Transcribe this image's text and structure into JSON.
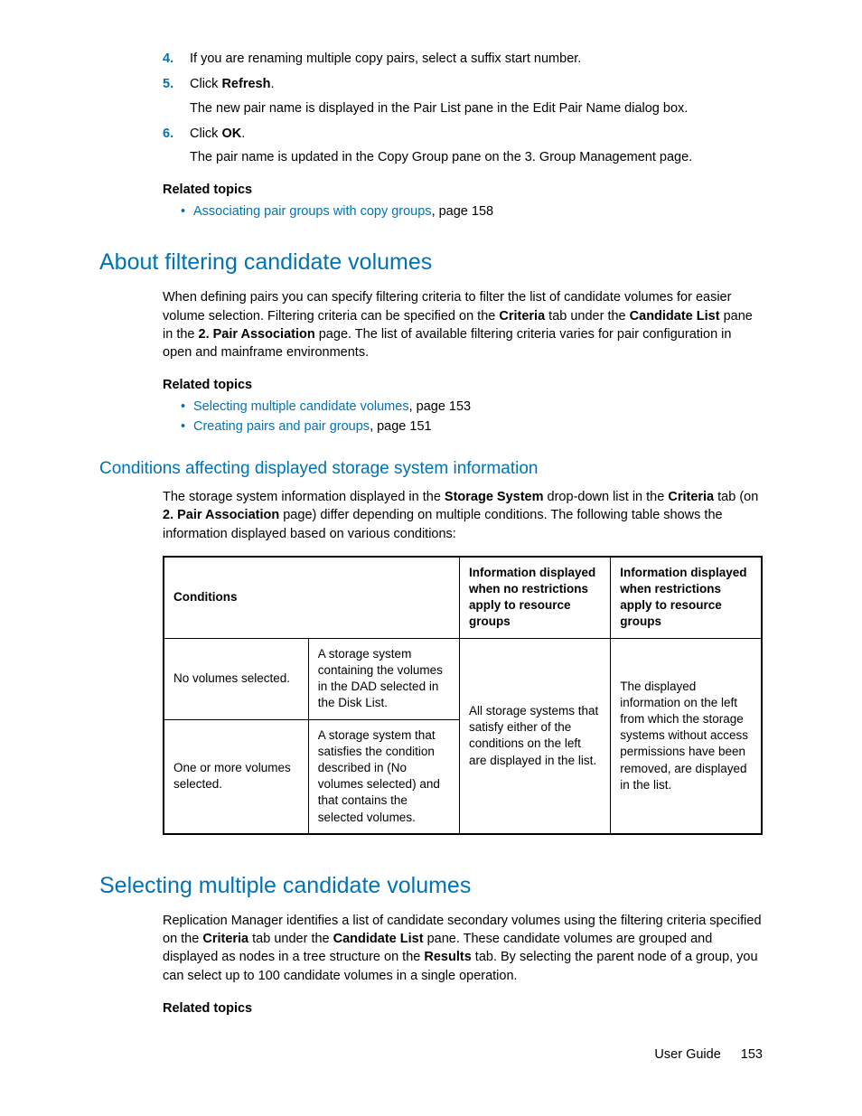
{
  "steps": [
    {
      "num": "4.",
      "text": "If you are renaming multiple copy pairs, select a suffix start number."
    },
    {
      "num": "5.",
      "prefix": "Click ",
      "bold": "Refresh",
      "suffix": ".",
      "sub": "The new pair name is displayed in the Pair List pane in the Edit Pair Name dialog box."
    },
    {
      "num": "6.",
      "prefix": "Click ",
      "bold": "OK",
      "suffix": ".",
      "sub": "The pair name is updated in the Copy Group pane on the 3. Group Management page."
    }
  ],
  "related_heading": "Related topics",
  "related1": [
    {
      "link": "Associating pair groups with copy groups",
      "tail": ", page 158"
    }
  ],
  "section1": {
    "heading": "About filtering candidate volumes",
    "para_parts": [
      "When defining pairs you can specify filtering criteria to filter the list of candidate volumes for easier volume selection. Filtering criteria can be specified on the ",
      "Criteria",
      " tab under the ",
      "Candidate List",
      " pane in the ",
      "2. Pair Association",
      " page. The list of available filtering criteria varies for pair configuration in open and mainframe environments."
    ]
  },
  "related2": [
    {
      "link": "Selecting multiple candidate volumes",
      "tail": ", page 153"
    },
    {
      "link": "Creating pairs and pair groups",
      "tail": ", page 151"
    }
  ],
  "subsection": {
    "heading": "Conditions affecting displayed storage system information",
    "para_parts": [
      "The storage system information displayed in the ",
      "Storage System",
      " drop-down list in the ",
      "Criteria",
      " tab (on ",
      "2. Pair Association",
      " page) differ depending on multiple conditions. The following table shows the information displayed based on various conditions:"
    ]
  },
  "table": {
    "headers": [
      "Conditions",
      "Information displayed when no restrictions apply to resource groups",
      "Information displayed when restrictions apply to resource groups"
    ],
    "rows": [
      {
        "c1": "No volumes selected.",
        "c2": "A storage system containing the volumes in the DAD selected in the Disk List."
      },
      {
        "c1": "One or more volumes selected.",
        "c2": "A storage system that satisfies the condition described in (No volumes selected) and that contains the selected volumes."
      }
    ],
    "merged_col3": "All storage systems that satisfy either of the conditions on the left are displayed in the list.",
    "merged_col4": "The displayed information on the left from which the storage systems without access permissions have been removed, are displayed in the list."
  },
  "section2": {
    "heading": "Selecting multiple candidate volumes",
    "para_parts": [
      "Replication Manager identifies a list of candidate secondary volumes using the filtering criteria specified on the ",
      "Criteria",
      " tab under the ",
      "Candidate List",
      " pane. These candidate volumes are grouped and displayed as nodes in a tree structure on the ",
      "Results",
      " tab.  By selecting the parent node of a group, you can select up to 100 candidate volumes in a single operation."
    ]
  },
  "footer": {
    "doc": "User Guide",
    "page": "153"
  }
}
